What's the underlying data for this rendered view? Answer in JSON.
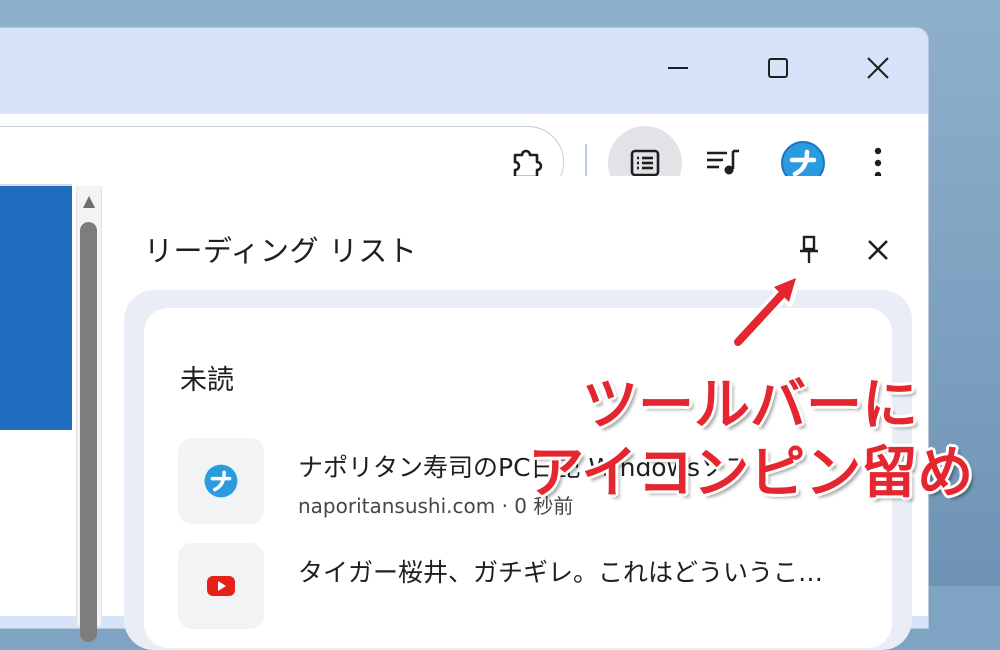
{
  "side_panel": {
    "title": "リーディング リスト",
    "section_heading": "未読",
    "items": [
      {
        "title": "ナポリタン寿司のPC日記 Windowsソフト",
        "meta": "naporitansushi.com · 0 秒前"
      },
      {
        "title": "タイガー桜井、ガチギレ。これはどういうこ…"
      }
    ]
  },
  "annotation": {
    "line1": "ツールバーに",
    "line2": "アイコンピン留め",
    "color": "#e3262f"
  },
  "colors": {
    "frame": "#d6e3f8",
    "active_button": "#e2e3e6",
    "list_frame": "#e9eef6",
    "page_blue": "#1f6dc0"
  },
  "icons": {
    "minimize": "minimize-icon",
    "maximize": "maximize-icon",
    "close": "close-icon",
    "extensions": "puzzle-icon",
    "reading_list": "reading-list-icon",
    "media": "media-control-icon",
    "profile": "profile-avatar-icon",
    "menu": "more-vertical-icon",
    "pin": "pin-icon",
    "arrow": "arrow-icon"
  }
}
